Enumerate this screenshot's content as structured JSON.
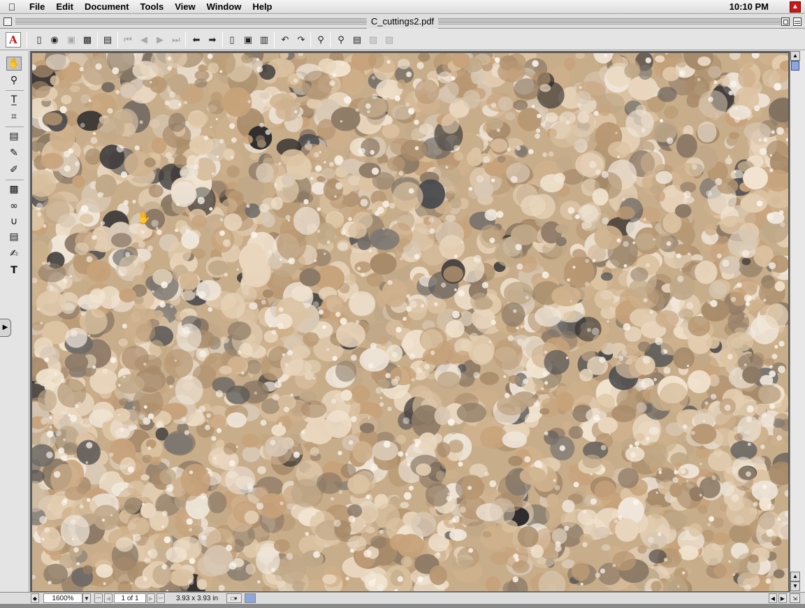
{
  "menubar": {
    "apple_icon": "apple-icon",
    "menus": [
      "File",
      "Edit",
      "Document",
      "Tools",
      "View",
      "Window",
      "Help"
    ],
    "clock": "10:10 PM",
    "app_icon": "acrobat-app-icon"
  },
  "window": {
    "title": "C_cuttings2.pdf"
  },
  "toolbar": {
    "logo": "acrobat-logo",
    "buttons": [
      {
        "name": "open-icon",
        "glyph": "📂"
      },
      {
        "name": "open-web-icon",
        "glyph": "🌐"
      },
      {
        "name": "save-icon",
        "glyph": "💾"
      },
      {
        "name": "print-icon",
        "glyph": "🖨"
      },
      {
        "name": "show-hide-navigation-icon",
        "glyph": "▤"
      },
      {
        "name": "first-page-icon",
        "glyph": "⏮"
      },
      {
        "name": "previous-page-icon",
        "glyph": "◀"
      },
      {
        "name": "next-page-icon",
        "glyph": "▶"
      },
      {
        "name": "last-page-icon",
        "glyph": "⏭"
      },
      {
        "name": "go-back-icon",
        "glyph": "⬅"
      },
      {
        "name": "go-forward-icon",
        "glyph": "➡"
      },
      {
        "name": "actual-size-icon",
        "glyph": "▯"
      },
      {
        "name": "fit-page-icon",
        "glyph": "▣"
      },
      {
        "name": "fit-width-icon",
        "glyph": "▥"
      },
      {
        "name": "rotate-left-icon",
        "glyph": "↶"
      },
      {
        "name": "rotate-right-icon",
        "glyph": "↷"
      },
      {
        "name": "find-icon",
        "glyph": "🔭"
      },
      {
        "name": "search-icon",
        "glyph": "🔍"
      },
      {
        "name": "search-results-icon",
        "glyph": "📑"
      },
      {
        "name": "previous-highlight-icon",
        "glyph": "⎘"
      },
      {
        "name": "next-highlight-icon",
        "glyph": "⎘"
      }
    ]
  },
  "tools": [
    {
      "name": "hand-tool-icon",
      "glyph": "✋"
    },
    {
      "name": "zoom-tool-icon",
      "glyph": "🔍"
    },
    {
      "name": "text-select-tool-icon",
      "glyph": "T"
    },
    {
      "name": "crop-tool-icon",
      "glyph": "⌗"
    },
    {
      "name": "note-tool-icon",
      "glyph": "🗒"
    },
    {
      "name": "pencil-tool-icon",
      "glyph": "✎"
    },
    {
      "name": "highlight-tool-icon",
      "glyph": "✐"
    },
    {
      "name": "movie-tool-icon",
      "glyph": "🎞"
    },
    {
      "name": "link-tool-icon",
      "glyph": "🔗"
    },
    {
      "name": "article-tool-icon",
      "glyph": "Ⴎ"
    },
    {
      "name": "form-tool-icon",
      "glyph": "▤"
    },
    {
      "name": "digital-signature-tool-icon",
      "glyph": "✍"
    },
    {
      "name": "touchup-text-tool-icon",
      "glyph": "T"
    }
  ],
  "document": {
    "image": "sand-grains-photo",
    "cursor": "hand-cursor-icon"
  },
  "statusbar": {
    "zoom": "1600%",
    "page": "1 of 1",
    "page_size": "3.93 x 3.93 in"
  },
  "colors": {
    "sand_base": "#c8ad8a",
    "accent_red": "#c61a1a",
    "scroll_thumb": "#8fa6dc"
  }
}
